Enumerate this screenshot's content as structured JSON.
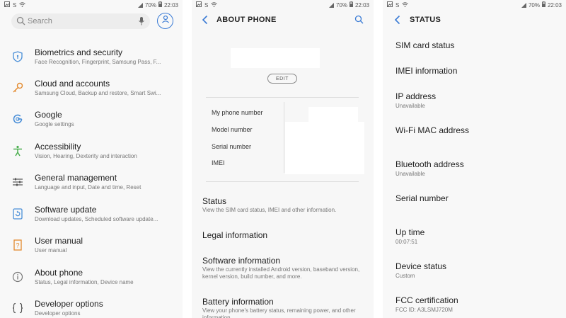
{
  "status_bar": {
    "left_glyph": "S",
    "battery": "70%",
    "time": "22:03"
  },
  "settings": {
    "search_placeholder": "Search",
    "items": [
      {
        "title": "Biometrics and security",
        "subtitle": "Face Recognition, Fingerprint, Samsung Pass, F...",
        "icon": "shield-icon"
      },
      {
        "title": "Cloud and accounts",
        "subtitle": "Samsung Cloud, Backup and restore, Smart Swi...",
        "icon": "key-icon"
      },
      {
        "title": "Google",
        "subtitle": "Google settings",
        "icon": "google-icon"
      },
      {
        "title": "Accessibility",
        "subtitle": "Vision, Hearing, Dexterity and interaction",
        "icon": "accessibility-icon"
      },
      {
        "title": "General management",
        "subtitle": "Language and input, Date and time, Reset",
        "icon": "sliders-icon"
      },
      {
        "title": "Software update",
        "subtitle": "Download updates, Scheduled software update...",
        "icon": "software-update-icon"
      },
      {
        "title": "User manual",
        "subtitle": "User manual",
        "icon": "manual-icon"
      },
      {
        "title": "About phone",
        "subtitle": "Status, Legal information, Device name",
        "icon": "info-icon"
      },
      {
        "title": "Developer options",
        "subtitle": "Developer options",
        "icon": "braces-icon"
      }
    ]
  },
  "about_phone": {
    "title": "ABOUT PHONE",
    "edit_label": "EDIT",
    "info_rows": [
      "My phone number",
      "Model number",
      "Serial number",
      "IMEI"
    ],
    "items": [
      {
        "title": "Status",
        "subtitle": "View the SIM card status, IMEI and other information."
      },
      {
        "title": "Legal information",
        "subtitle": ""
      },
      {
        "title": "Software information",
        "subtitle": "View the currently installed Android version, baseband version, kernel version, build number, and more."
      },
      {
        "title": "Battery information",
        "subtitle": "View your phone's battery status, remaining power, and other information."
      }
    ]
  },
  "status_screen": {
    "title": "STATUS",
    "items": [
      {
        "title": "SIM card status",
        "subtitle": ""
      },
      {
        "title": "IMEI information",
        "subtitle": ""
      },
      {
        "title": "IP address",
        "subtitle": "Unavailable"
      },
      {
        "title": "Wi-Fi MAC address",
        "subtitle": ""
      },
      {
        "title": "Bluetooth address",
        "subtitle": "Unavailable"
      },
      {
        "title": "Serial number",
        "subtitle": ""
      },
      {
        "title": "Up time",
        "subtitle": "00:07:51"
      },
      {
        "title": "Device status",
        "subtitle": "Custom"
      },
      {
        "title": "FCC certification",
        "subtitle": "FCC ID: A3LSMJ720M"
      }
    ]
  },
  "colors": {
    "accent": "#3a7bd5",
    "icon_orange": "#e38a2e",
    "icon_green": "#4caf50",
    "icon_blue": "#4a8fd8"
  }
}
